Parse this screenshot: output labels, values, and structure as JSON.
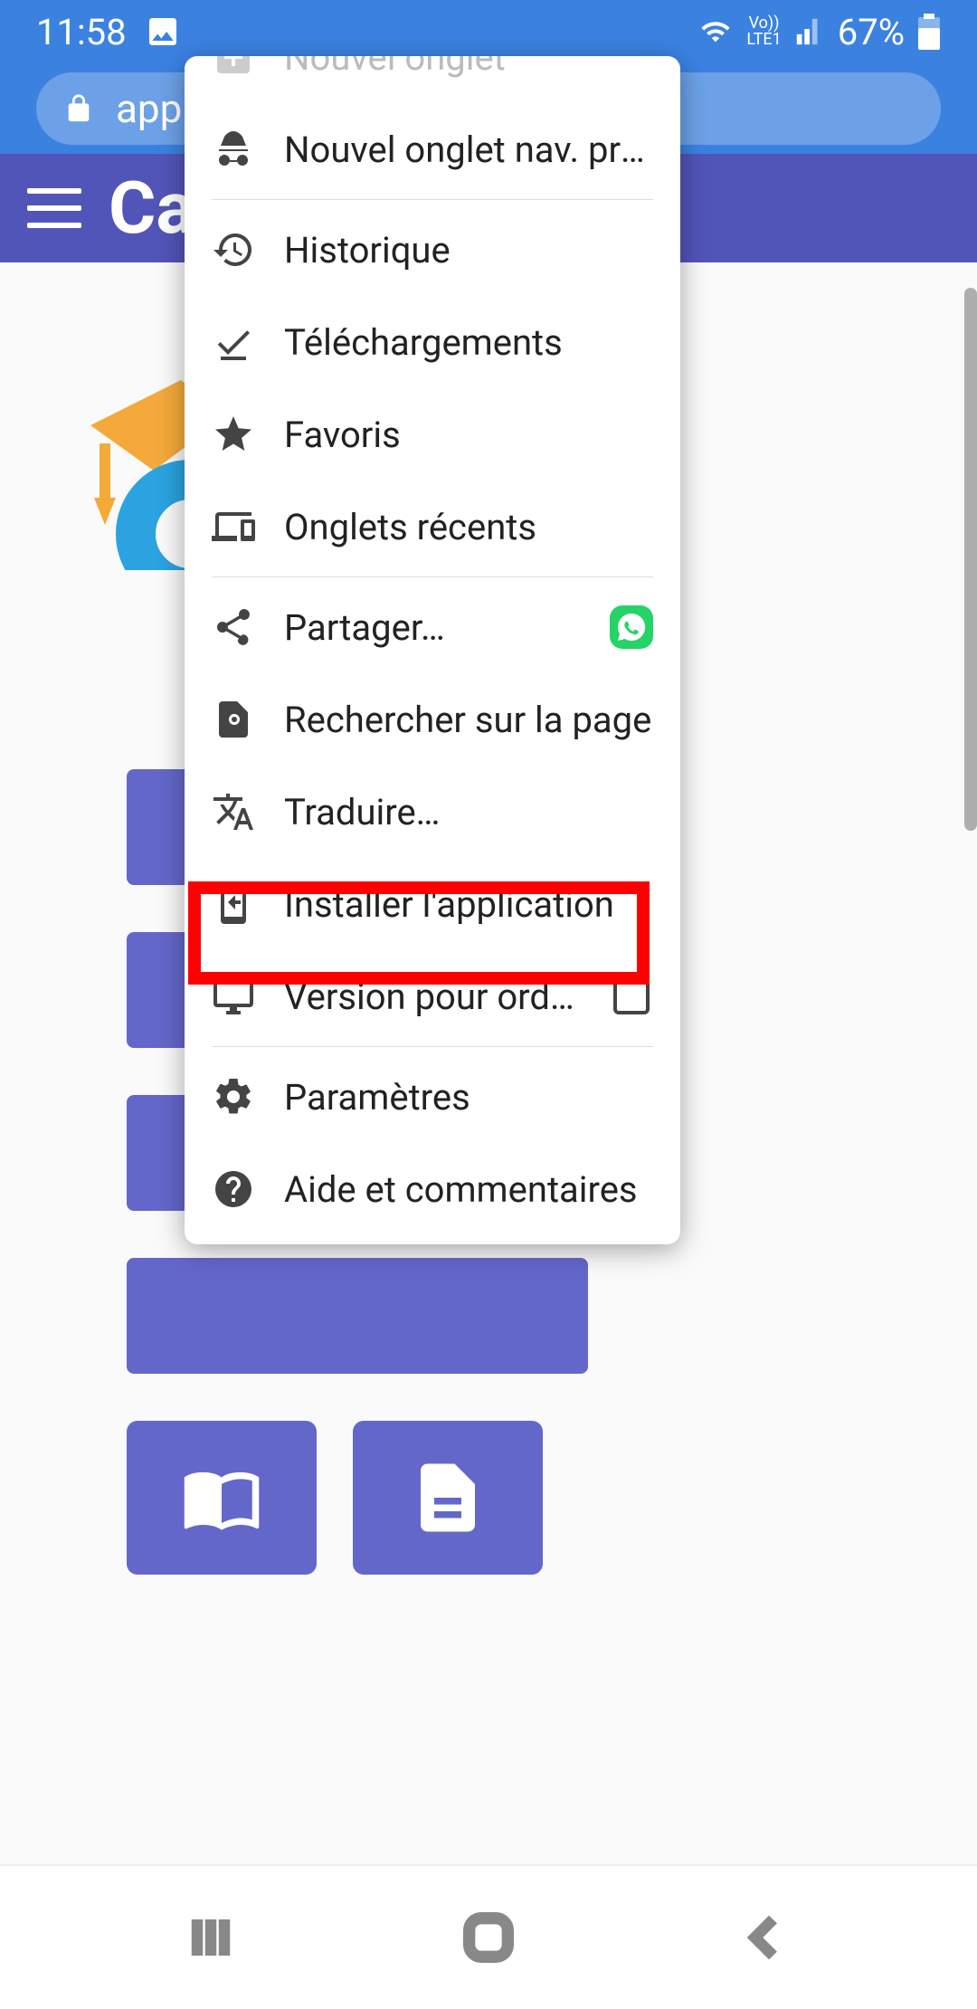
{
  "status": {
    "time": "11:58",
    "lte_label": "Vo))\nLTE1",
    "battery": "67%"
  },
  "urlbar": {
    "host": "app.cab"
  },
  "app": {
    "title_visible": "Ca"
  },
  "menu": {
    "new_tab": "Nouvel onglet",
    "incognito": "Nouvel onglet nav. privée",
    "history": "Historique",
    "downloads": "Téléchargements",
    "bookmarks": "Favoris",
    "recent_tabs": "Onglets récents",
    "share": "Partager…",
    "find": "Rechercher sur la page",
    "translate": "Traduire…",
    "install": "Installer l'application",
    "desktop": "Version pour ordin…",
    "settings": "Paramètres",
    "help": "Aide et commentaires"
  },
  "icons": {
    "image": "image-icon",
    "wifi": "wifi-icon",
    "signal": "signal-icon",
    "battery": "battery-icon",
    "lock": "lock-icon",
    "menu": "hamburger-icon",
    "new_tab": "plus-square-icon",
    "incognito": "incognito-icon",
    "history": "history-icon",
    "downloads": "download-done-icon",
    "bookmarks": "star-icon",
    "recent_tabs": "devices-icon",
    "share": "share-icon",
    "find": "find-in-page-icon",
    "translate": "translate-icon",
    "install": "install-mobile-icon",
    "desktop": "desktop-icon",
    "settings": "gear-icon",
    "help": "help-icon",
    "whatsapp": "whatsapp-icon",
    "checkbox": "checkbox-empty-icon",
    "recents_nav": "recents-nav-icon",
    "home_nav": "home-nav-icon",
    "back_nav": "back-nav-icon"
  },
  "highlight": {
    "target": "install"
  },
  "colors": {
    "chrome_blue": "#3b82e0",
    "app_purple": "#5255b8",
    "highlight_red": "#ff0000",
    "whatsapp_green": "#25d366"
  }
}
